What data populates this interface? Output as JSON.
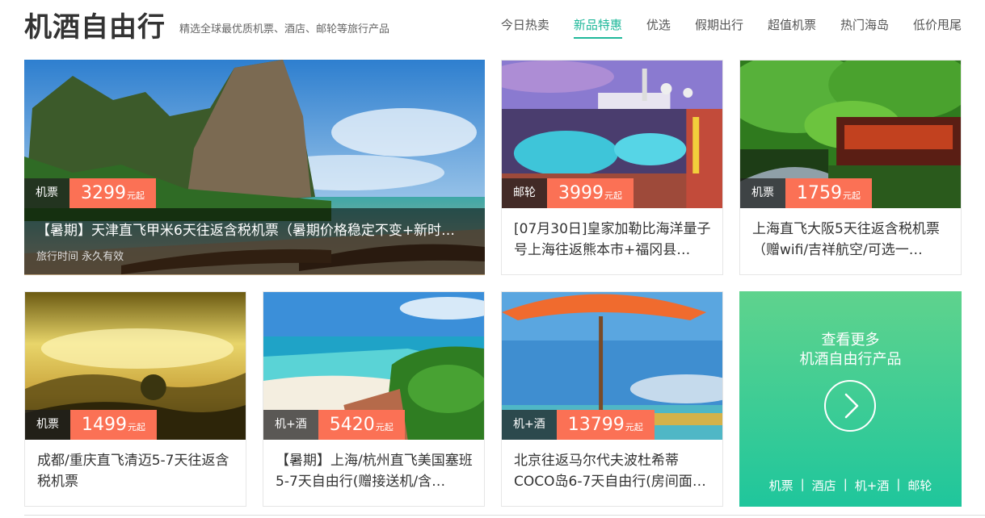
{
  "header": {
    "brand": "机酒自由行",
    "slogan": "精选全球最优质机票、酒店、邮轮等旅行产品",
    "nav": [
      "今日热卖",
      "新品特惠",
      "优选",
      "假期出行",
      "超值机票",
      "热门海岛",
      "低价甩尾"
    ],
    "active_nav": "新品特惠"
  },
  "featured": {
    "tag": "机票",
    "price": "3299",
    "unit": "元起",
    "title": "【暑期】天津直飞甲米6天往返含税机票（暑期价格稳定不变+新时…",
    "subtitle": "旅行时间 永久有效"
  },
  "cards": [
    {
      "tag": "邮轮",
      "price": "3999",
      "unit": "元起",
      "title": "[07月30日]皇家加勒比海洋量子号上海往返熊本市+福冈县…"
    },
    {
      "tag": "机票",
      "price": "1759",
      "unit": "元起",
      "title": "上海直飞大阪5天往返含税机票（赠wifi/吉祥航空/可选一…"
    },
    {
      "tag": "机票",
      "price": "1499",
      "unit": "元起",
      "title": "成都/重庆直飞清迈5-7天往返含税机票"
    },
    {
      "tag": "机+酒",
      "price": "5420",
      "unit": "元起",
      "title": "【暑期】上海/杭州直飞美国塞班5-7天自由行(赠接送机/含…"
    },
    {
      "tag": "机+酒",
      "price": "13799",
      "unit": "元起",
      "title": "北京往返马尔代夫波杜希蒂COCO岛6-7天自由行(房间面…"
    }
  ],
  "more": {
    "line1": "查看更多",
    "line2": "机酒自由行产品",
    "links": [
      "机票",
      "酒店",
      "机+酒",
      "邮轮"
    ],
    "separator": "|"
  },
  "colors": {
    "accent": "#1fb89a",
    "price_bg": "#fb7155",
    "more_gradient_top": "#5fd38d",
    "more_gradient_bottom": "#1fc69c"
  }
}
